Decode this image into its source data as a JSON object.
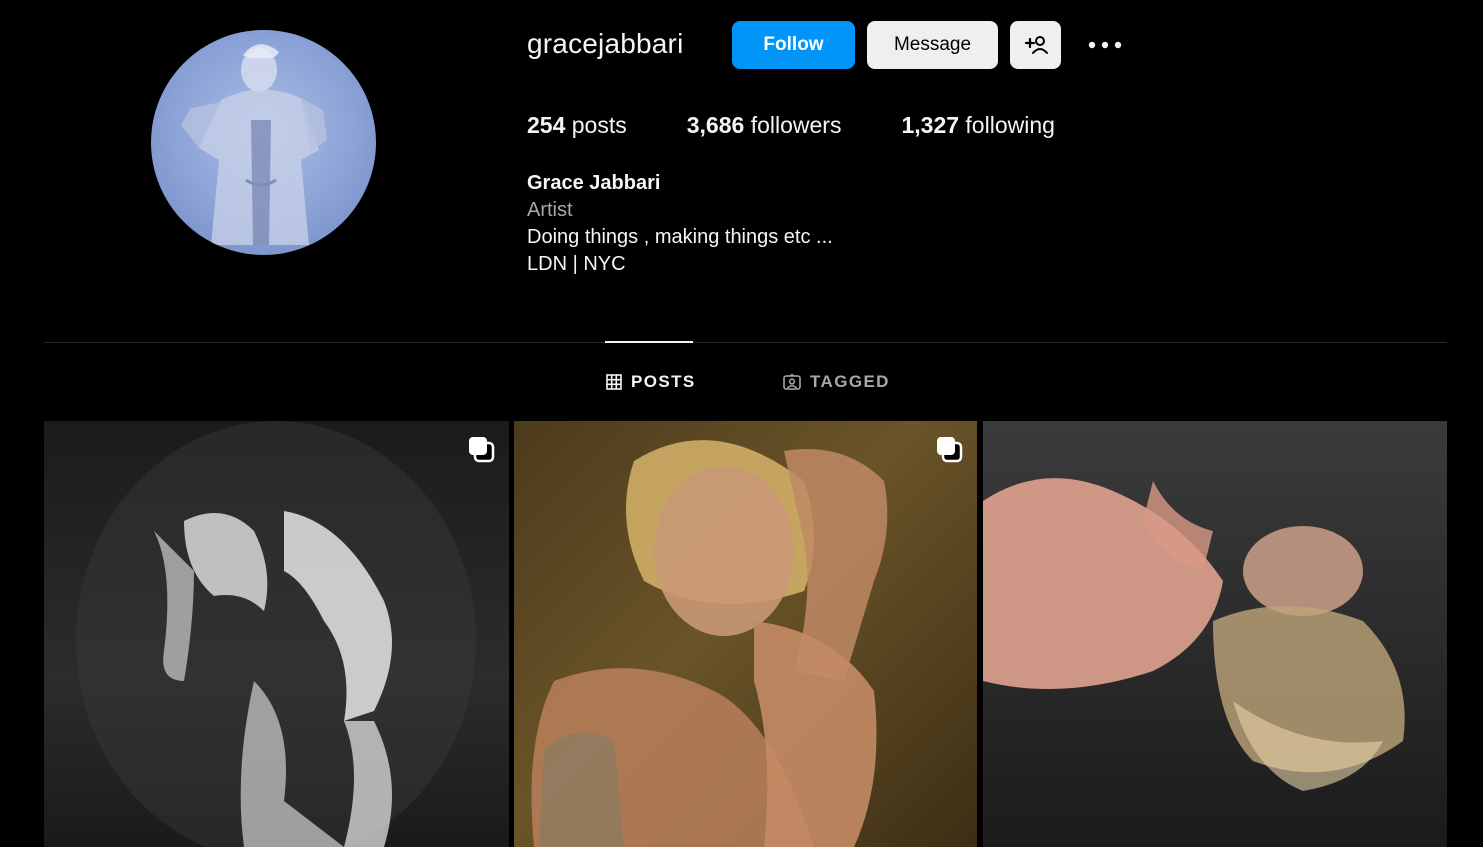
{
  "profile": {
    "username": "gracejabbari",
    "avatar_icon": "profile-photo"
  },
  "actions": {
    "follow_label": "Follow",
    "message_label": "Message",
    "add_user_icon": "add-person-icon",
    "more_icon": "more-options-icon"
  },
  "stats": {
    "posts_count": "254",
    "posts_label": "posts",
    "followers_count": "3,686",
    "followers_label": "followers",
    "following_count": "1,327",
    "following_label": "following"
  },
  "bio": {
    "name": "Grace Jabbari",
    "category": "Artist",
    "line1": "Doing things , making things etc ...",
    "line2": "LDN | NYC"
  },
  "tabs": [
    {
      "label": "POSTS",
      "icon": "grid-icon",
      "active": true
    },
    {
      "label": "TAGGED",
      "icon": "tagged-icon",
      "active": false
    }
  ],
  "posts": [
    {
      "type": "carousel",
      "icon": "multiple-posts-icon"
    },
    {
      "type": "carousel",
      "icon": "multiple-posts-icon"
    },
    {
      "type": "single"
    }
  ],
  "colors": {
    "background": "#000000",
    "follow_button": "#0095f6",
    "secondary_button": "#efefef",
    "muted_text": "#a8a8a8",
    "divider": "#262626"
  }
}
